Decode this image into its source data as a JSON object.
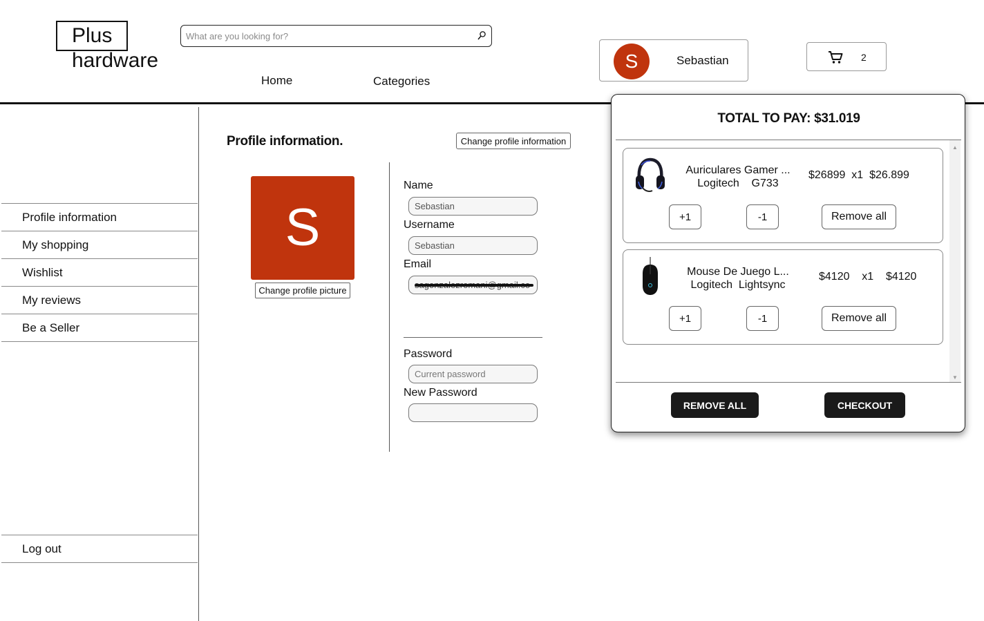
{
  "brand": {
    "line1": "Plus",
    "line2": "hardware"
  },
  "search": {
    "placeholder": "What are you looking for?",
    "icon": "search-icon"
  },
  "nav": {
    "home": "Home",
    "categories": "Categories"
  },
  "user": {
    "initial": "S",
    "name": "Sebastian",
    "avatar_color": "#c0340d"
  },
  "cart_button": {
    "count": "2",
    "icon": "cart-icon"
  },
  "sidebar": {
    "items": [
      {
        "label": "Profile information"
      },
      {
        "label": "My shopping"
      },
      {
        "label": "Wishlist"
      },
      {
        "label": "My reviews"
      },
      {
        "label": "Be a Seller"
      }
    ],
    "logout": "Log out"
  },
  "profile": {
    "title": "Profile information.",
    "change_info_label": "Change profile information",
    "avatar_initial": "S",
    "change_picture_label": "Change profile picture",
    "fields": {
      "name_label": "Name",
      "name_value": "Sebastian",
      "username_label": "Username",
      "username_value": "Sebastian",
      "email_label": "Email",
      "email_value": "sagonzalezromani@gmail.co",
      "password_label": "Password",
      "password_placeholder": "Current password",
      "new_password_label": "New Password",
      "new_password_placeholder": ""
    }
  },
  "cart": {
    "total_label": "TOTAL TO PAY: $31.019",
    "items": [
      {
        "name_line1": "Auriculares Gamer ...",
        "name_line2": "Logitech    G733",
        "price_line": "$26899  x1  $26.899",
        "plus": "+1",
        "minus": "-1",
        "remove": "Remove all"
      },
      {
        "name_line1": "Mouse De Juego L...",
        "name_line2": "Logitech  Lightsync",
        "price_line": "$4120    x1    $4120",
        "plus": "+1",
        "minus": "-1",
        "remove": "Remove all"
      }
    ],
    "remove_all_label": "REMOVE ALL",
    "checkout_label": "CHECKOUT"
  }
}
